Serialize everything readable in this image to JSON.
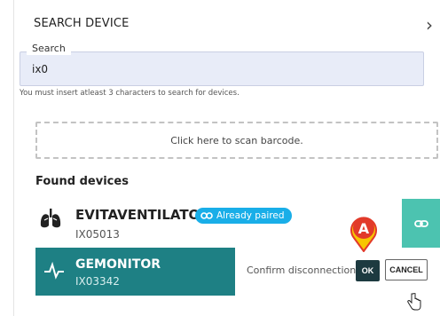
{
  "header": {
    "title": "SEARCH DEVICE",
    "chevron_icon": "chevron-right-icon"
  },
  "search": {
    "legend": "Search",
    "value": "ix0",
    "hint": "You must insert atleast 3 characters to search for devices."
  },
  "scan": {
    "label": "Click here to scan barcode."
  },
  "found": {
    "title": "Found devices",
    "devices": [
      {
        "name": "EVITAVENTILATOR",
        "id": "IX05013",
        "icon": "lungs-icon",
        "badge": "Already paired",
        "badge_icon": "link-icon",
        "action_icon": "unlink-icon"
      },
      {
        "name": "GEMONITOR",
        "id": "IX03342",
        "icon": "pulse-icon",
        "confirm_text": "Confirm disconnection",
        "ok_label": "OK",
        "cancel_label": "CANCEL"
      }
    ]
  },
  "annotation": {
    "marker_label": "A"
  },
  "colors": {
    "teal_dark": "#1e8084",
    "teal_light": "#4cc3b0",
    "badge_blue": "#19aee8",
    "marker_red": "#e23a2a",
    "marker_yellow": "#f7c600"
  }
}
